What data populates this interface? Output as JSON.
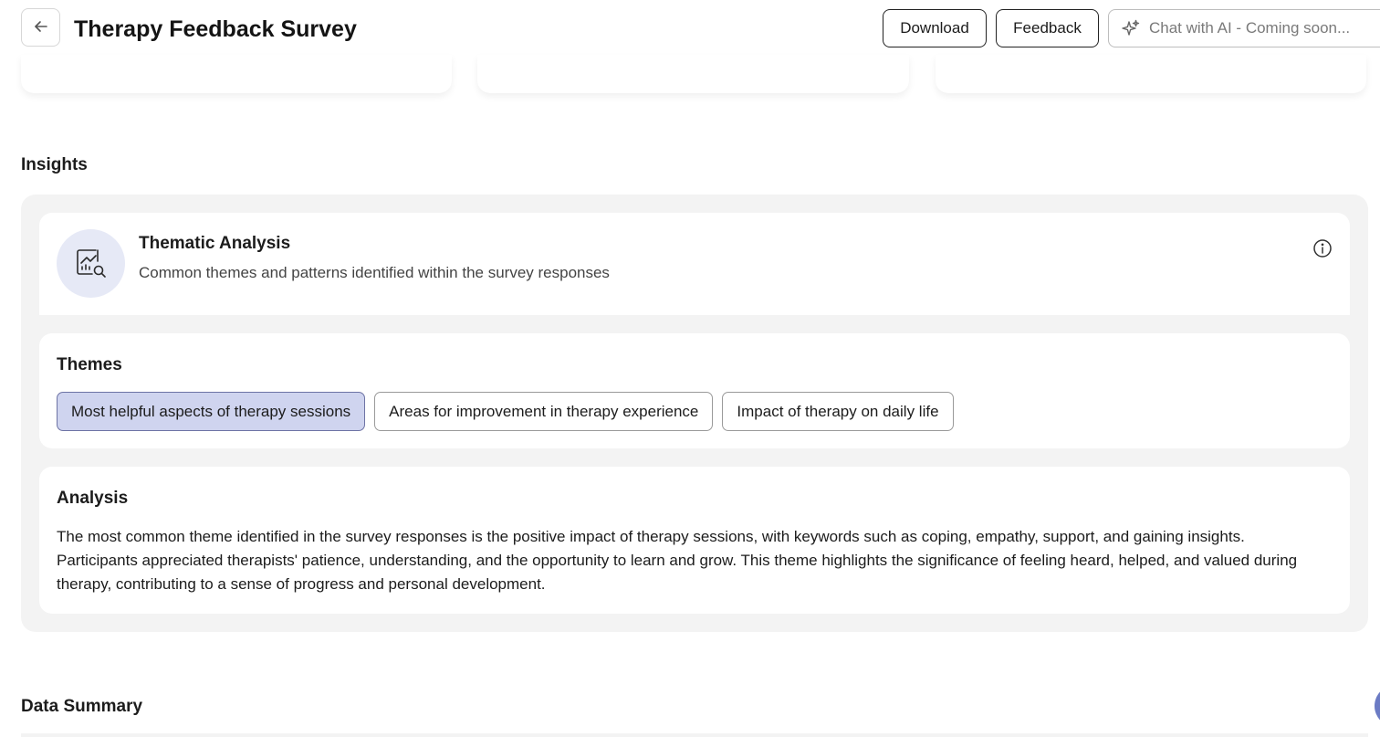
{
  "header": {
    "title": "Therapy Feedback Survey",
    "back_icon": "arrow-left-icon",
    "download_label": "Download",
    "feedback_label": "Feedback",
    "chat_label": "Chat with AI - Coming soon...",
    "chat_icon": "sparkle-icon"
  },
  "insights": {
    "heading": "Insights",
    "thematic": {
      "title": "Thematic Analysis",
      "subtitle": "Common themes and patterns identified within the survey responses",
      "icon": "chart-magnifier-icon",
      "info_icon": "info-icon"
    },
    "themes": {
      "heading": "Themes",
      "chips": [
        {
          "label": "Most helpful aspects of therapy sessions",
          "active": true
        },
        {
          "label": "Areas for improvement in therapy experience",
          "active": false
        },
        {
          "label": "Impact of therapy on daily life",
          "active": false
        }
      ]
    },
    "analysis": {
      "heading": "Analysis",
      "text": "The most common theme identified in the survey responses is the positive impact of therapy sessions, with keywords such as coping, empathy, support, and gaining insights. Participants appreciated therapists' patience, understanding, and the opportunity to learn and grow. This theme highlights the significance of feeling heard, helped, and valued during therapy, contributing to a sense of progress and personal development."
    }
  },
  "data_summary": {
    "heading": "Data Summary"
  },
  "colors": {
    "active_chip_bg": "#cfd4ef",
    "icon_circle_bg": "#e6e9f6",
    "panel_bg": "#f3f3f3",
    "fab": "#6b7bc4"
  }
}
